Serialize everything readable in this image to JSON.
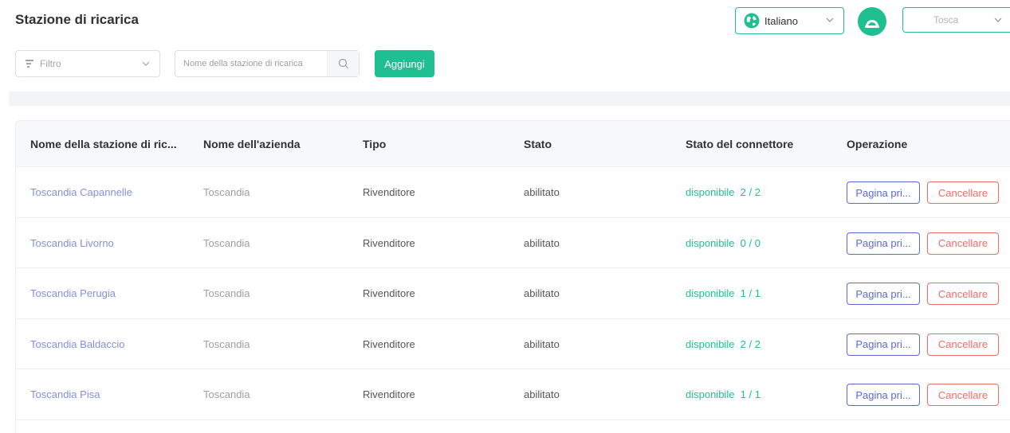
{
  "page": {
    "title": "Stazione di ricarica"
  },
  "header": {
    "language": "Italiano",
    "user_name": "Tosca"
  },
  "toolbar": {
    "filter_placeholder": "Filtro",
    "search_placeholder": "Nome della stazione di ricarica",
    "add_label": "Aggiungi"
  },
  "table": {
    "columns": [
      "Nome della stazione di ric...",
      "Nome dell'azienda",
      "Tipo",
      "Stato",
      "Stato del connettore",
      "Operazione"
    ],
    "rows": [
      {
        "name": "Toscandia Capannelle",
        "company": "Toscandia",
        "type": "Rivenditore",
        "status": "abilitato",
        "connector_label": "disponibile",
        "connector_count": "2 / 2"
      },
      {
        "name": "Toscandia Livorno",
        "company": "Toscandia",
        "type": "Rivenditore",
        "status": "abilitato",
        "connector_label": "disponibile",
        "connector_count": "0 / 0"
      },
      {
        "name": "Toscandia Perugia",
        "company": "Toscandia",
        "type": "Rivenditore",
        "status": "abilitato",
        "connector_label": "disponibile",
        "connector_count": "1 / 1"
      },
      {
        "name": "Toscandia Baldaccio",
        "company": "Toscandia",
        "type": "Rivenditore",
        "status": "abilitato",
        "connector_label": "disponibile",
        "connector_count": "2 / 2"
      },
      {
        "name": "Toscandia Pisa",
        "company": "Toscandia",
        "type": "Rivenditore",
        "status": "abilitato",
        "connector_label": "disponibile",
        "connector_count": "1 / 1"
      }
    ],
    "main_page_label": "Pagina pri...",
    "delete_label": "Cancellare"
  },
  "colors": {
    "accent": "#1fbf91",
    "link": "#5b6ad0",
    "danger": "#f06b6b"
  }
}
